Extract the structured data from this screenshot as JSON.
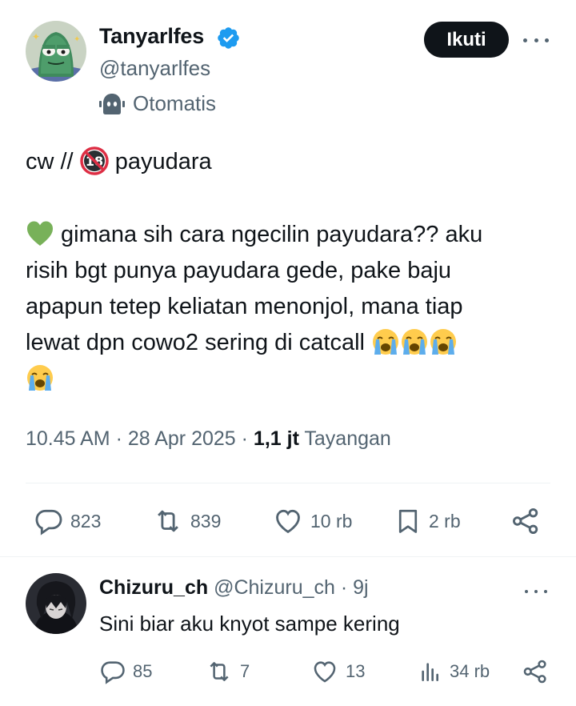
{
  "tweet": {
    "author": {
      "name": "Tanyarlfes",
      "handle": "@tanyarlfes",
      "verified": true,
      "automated_label": "Otomatis",
      "avatar": "green-cartoon-character-avatar"
    },
    "follow_label": "Ikuti",
    "more_icon": "more-horizontal-icon",
    "lines": {
      "l1_pre": "cw // ",
      "l1_emoji": "no-one-under-18-emoji",
      "l1_post": " payudara",
      "l2_emoji": "green-heart-emoji",
      "l2_text": " gimana sih cara ngecilin payudara?? aku",
      "l3_text": "risih bgt punya payudara gede, pake baju",
      "l4_text": "apapun tetep keliatan menonjol, mana tiap",
      "l5_text": "lewat dpn cowo2 sering di catcall ",
      "l5_emojis": [
        "loudly-crying-face-emoji",
        "loudly-crying-face-emoji",
        "loudly-crying-face-emoji"
      ],
      "l6_emojis": [
        "loudly-crying-face-emoji"
      ]
    },
    "meta": {
      "time": "10.45 AM",
      "sep1": " · ",
      "date": "28 Apr 2025",
      "sep2": " · ",
      "views": "1,1 jt",
      "views_label": " Tayangan"
    },
    "actions": {
      "reply_count": "823",
      "retweet_count": "839",
      "like_count": "10 rb",
      "bookmark_count": "2 rb"
    },
    "accent_color": "#1d9bf0"
  },
  "reply": {
    "name": "Chizuru_ch",
    "handle": "@Chizuru_ch",
    "sep": " · ",
    "time": "9j",
    "text": "Sini biar aku knyot sampe kering",
    "avatar": "dark-haired-anime-character-avatar",
    "actions": {
      "reply_count": "85",
      "retweet_count": "7",
      "like_count": "13",
      "view_count": "34 rb"
    }
  }
}
